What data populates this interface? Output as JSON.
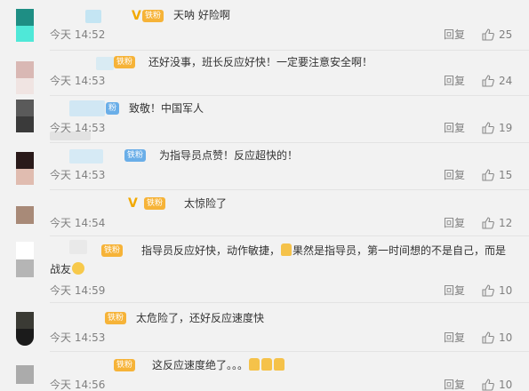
{
  "colors": {
    "background": "#f2f2f2",
    "meta_gray": "#808080",
    "fan_badge_gold": "#f6b338",
    "fan_badge_blue": "#6aaee8",
    "verified_gold": "#f2a900"
  },
  "icons": {
    "like": "thumbs-up-outline-icon",
    "verified": "verified-v-icon"
  },
  "comments": [
    {
      "badge": "铁粉",
      "text": "天呐 好险啊",
      "time": "今天 14:52",
      "reply": "回复",
      "likes": "25"
    },
    {
      "badge": "铁粉",
      "text": "还好没事，班长反应好快！一定要注意安全啊！",
      "time": "今天 14:53",
      "reply": "回复",
      "likes": "24"
    },
    {
      "badge": "粉",
      "text": "致敬！中国军人",
      "time": "今天 14:53",
      "reply": "回复",
      "likes": "19"
    },
    {
      "badge": "铁粉",
      "text": "为指导员点赞！反应超快的！",
      "time": "今天 14:53",
      "reply": "回复",
      "likes": "15"
    },
    {
      "badge": "铁粉",
      "text": "太惊险了",
      "time": "今天 14:54",
      "reply": "回复",
      "likes": "12"
    },
    {
      "badge": "铁粉",
      "text_a": "指导员反应好快，动作敏捷，",
      "text_b": "果然是指导员，第一时间想的不是自己，而是",
      "text_c": "战友",
      "time": "今天 14:59",
      "reply": "回复",
      "likes": "10"
    },
    {
      "badge": "铁粉",
      "text": "太危险了，还好反应速度快",
      "time": "今天 14:53",
      "reply": "回复",
      "likes": "10"
    },
    {
      "badge": "铁粉",
      "text": "这反应速度绝了。。。",
      "time": "今天 14:56",
      "reply": "回复",
      "likes": "10"
    }
  ]
}
